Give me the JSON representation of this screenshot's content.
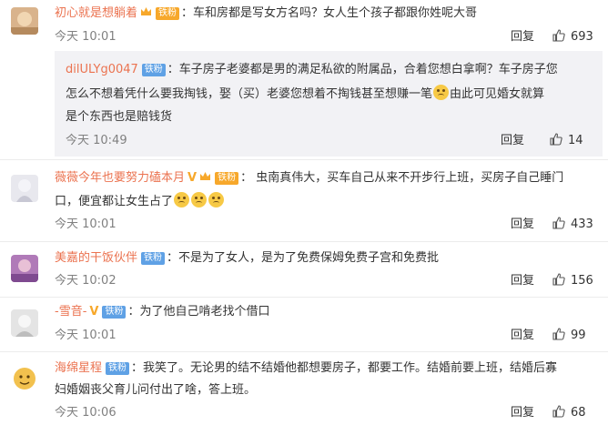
{
  "comments": [
    {
      "name": "初心就是想躺着",
      "badge": "铁粉",
      "text": "：车和房都是写女方名吗？女人生个孩子都跟你姓呢大哥",
      "time": "今天 10:01",
      "reply_label": "回复",
      "likes": "693",
      "avatar_color": "#d9b38c"
    },
    {
      "name": "薇薇今年也要努力磕本月",
      "badge": "铁粉",
      "text_line1": "：  虫南真伟大，买车自己从来不开步行上班，买房子自己睡门",
      "text_line2": "口，便宜都让女生占了",
      "time": "今天 10:01",
      "reply_label": "回复",
      "likes": "433",
      "avatar_color": "#e8e8ee"
    },
    {
      "name": "美嘉的干饭伙伴",
      "badge": "铁粉",
      "text": "：不是为了女人，是为了免费保姆免费子宫和免费批",
      "time": "今天 10:02",
      "reply_label": "回复",
      "likes": "156",
      "avatar_color": "#b07ab8"
    },
    {
      "name": "-雪音-",
      "badge": "铁粉",
      "text": "：为了他自己啃老找个借口",
      "time": "今天 10:01",
      "reply_label": "回复",
      "likes": "99",
      "avatar_color": "#e4e4e4"
    },
    {
      "name": "海绵星程",
      "badge": "铁粉",
      "text_line1": "：我笑了。无论男的结不结婚他都想要房子，都要工作。结婚前要上班，结婚后寡",
      "text_line2": "妇婚姻丧父育儿问付出了啥，答上班。",
      "time": "今天 10:06",
      "reply_label": "回复",
      "likes": "68",
      "avatar_color": "#f2c14e"
    }
  ],
  "reply": {
    "name": "dilULYg0047",
    "badge": "铁粉",
    "line1": "：车子房子老婆都是男的满足私欲的附属品，合着您想白拿啊？车子房子您",
    "line2a": "怎么不想着凭什么要我掏钱，娶（买）老婆您想着不掏钱甚至想赚一笔",
    "line2b": "由此可见婚女就算",
    "line3": "是个东西也是赔钱货",
    "time": "今天 10:49",
    "reply_label": "回复",
    "likes": "14"
  },
  "colors": {
    "name": "#eb7350",
    "badge": "#5fa1e5",
    "meta": "#808080"
  },
  "icons": [
    "thumbs-up-icon",
    "crown-icon",
    "v-verified-icon",
    "emoji-icon"
  ]
}
